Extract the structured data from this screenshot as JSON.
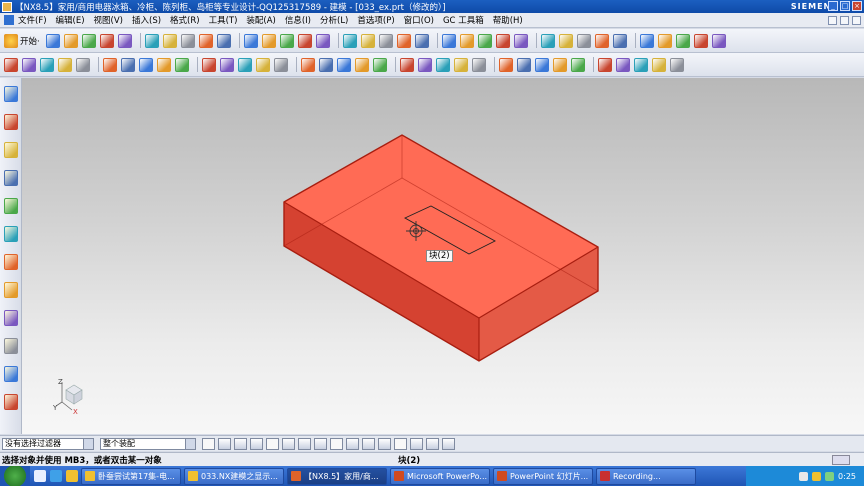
{
  "window": {
    "title": "【NX8.5】家用/商用电器冰箱、冷柜、陈列柜、岛柜等专业设计-QQ125317589 - 建模 - [033_ex.prt（修改的）]",
    "brand": "SIEMENS",
    "min_glyph": "_",
    "max_glyph": "□",
    "close_glyph": "×"
  },
  "menu": {
    "items": [
      "文件(F)",
      "编辑(E)",
      "视图(V)",
      "插入(S)",
      "格式(R)",
      "工具(T)",
      "装配(A)",
      "信息(I)",
      "分析(L)",
      "首选项(P)",
      "窗口(O)",
      "GC 工具箱",
      "帮助(H)"
    ]
  },
  "toolbar": {
    "start_label": "开始·",
    "row1_icons": [
      "new-icon",
      "open-icon",
      "save-icon",
      "cut-icon",
      "copy-icon",
      "paste-icon",
      "undo-icon",
      "redo-icon",
      "repeat-icon",
      "touch-icon",
      "view-orient-icon",
      "snap-icon",
      "render-icon",
      "shaded-icon",
      "layer-icon",
      "color-icon",
      "wcs-icon",
      "select-icon",
      "measure-icon",
      "feature-icon",
      "sketch-icon",
      "extrude-icon",
      "revolve-icon",
      "hole-icon",
      "block-icon",
      "cylinder-icon",
      "blend-icon",
      "chamfer-icon",
      "shell-icon",
      "mirror-icon",
      "pattern-icon",
      "trim-icon",
      "sew-icon",
      "sweep-icon",
      "surface-icon"
    ],
    "row2_icons": [
      "point-icon",
      "datum-plane-icon",
      "datum-axis-icon",
      "csys-icon",
      "curve-icon",
      "line-icon",
      "arc-icon",
      "spline-icon",
      "helix-icon",
      "offset-icon",
      "project-icon",
      "intersect-icon",
      "extract-icon",
      "unite-icon",
      "subtract-icon",
      "intersect-body-icon",
      "split-icon",
      "pocket-icon",
      "boss-icon",
      "pad-icon",
      "slot-icon",
      "groove-icon",
      "rib-icon",
      "draft-icon",
      "thicken-icon",
      "scale-icon",
      "wrap-icon",
      "emboss-icon",
      "offset-face-icon",
      "replace-face-icon",
      "move-face-icon",
      "delete-face-icon",
      "resize-icon",
      "pull-icon",
      "transform-icon"
    ]
  },
  "left_toolbar": {
    "icons": [
      "assembly-navigator-icon",
      "constraint-navigator-icon",
      "part-navigator-icon",
      "reuse-library-icon",
      "hd3d-icon",
      "web-browser-icon",
      "history-icon",
      "system-materials-icon",
      "process-studio-icon",
      "roles-icon",
      "system-scene-icon",
      "palette-icon"
    ]
  },
  "viewport": {
    "tooltip": "块(2)",
    "colors": {
      "face_top": "#ff6b55",
      "face_front": "#d54231",
      "face_right": "#e45a46",
      "edge": "#a81e10"
    },
    "triad": {
      "x": "X",
      "y": "Y",
      "z": "Z"
    }
  },
  "selection_bar": {
    "filter_value": "没有选择过滤器",
    "scope_value": "整个装配"
  },
  "status": {
    "prompt": "选择对象并使用 MB3，或者双击某一对象",
    "info": "块(2)"
  },
  "taskbar": {
    "tasks": [
      {
        "label": "卧蚕尝试第17集-电...",
        "icon": "folder-icon",
        "active": false
      },
      {
        "label": "033.NX建模之显示...",
        "icon": "folder-icon",
        "active": false
      },
      {
        "label": "【NX8.5】家用/商...",
        "icon": "nx-icon",
        "active": true
      },
      {
        "label": "Microsoft PowerPo...",
        "icon": "powerpoint-icon",
        "active": false
      },
      {
        "label": "PowerPoint 幻灯片...",
        "icon": "powerpoint-icon",
        "active": false
      },
      {
        "label": "Recording...",
        "icon": "recording-icon",
        "active": false
      }
    ],
    "clock": "0:25"
  }
}
